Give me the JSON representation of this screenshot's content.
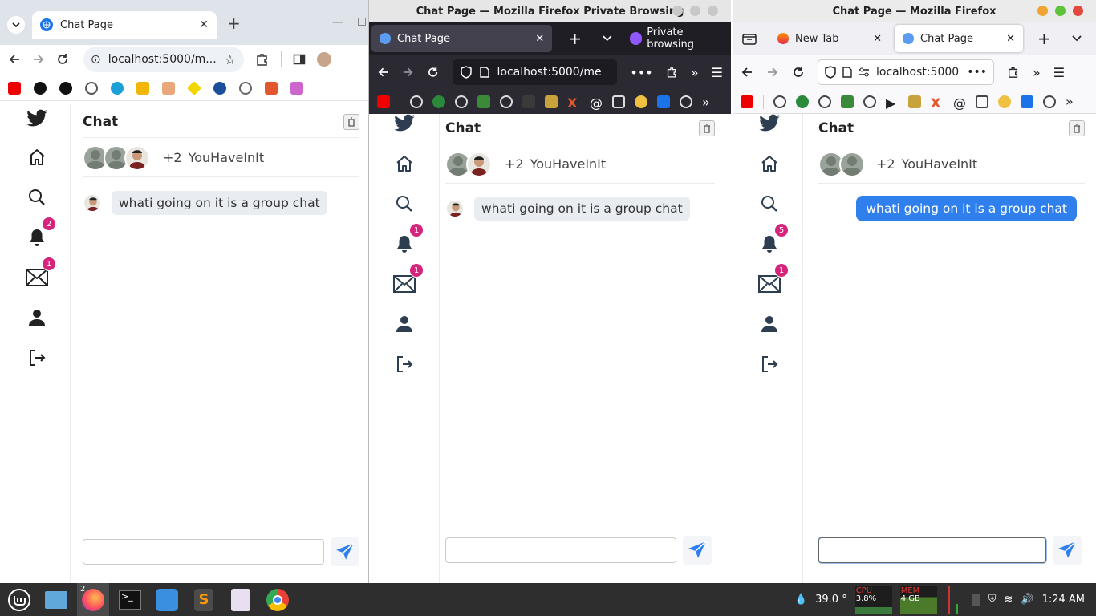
{
  "chrome": {
    "tab_title": "Chat Page",
    "url": "localhost:5000/m..."
  },
  "ff_private": {
    "window_title": "Chat Page — Mozilla Firefox Private Browsing",
    "tab_title": "Chat Page",
    "private_label": "Private browsing",
    "url": "localhost:5000/me"
  },
  "ff_normal": {
    "window_title": "Chat Page — Mozilla Firefox",
    "tabs": [
      {
        "label": "New Tab"
      },
      {
        "label": "Chat Page"
      }
    ],
    "url": "localhost:5000"
  },
  "app": {
    "chat_title": "Chat",
    "members_extra": "+2",
    "members_name": "YouHaveInIt",
    "message_text": "whati going on it is a group chat",
    "pages": [
      {
        "notif_badge": "2",
        "mail_badge": "1"
      },
      {
        "notif_badge": "1",
        "mail_badge": "1"
      },
      {
        "notif_badge": "5",
        "mail_badge": "1"
      }
    ]
  },
  "taskbar": {
    "firefox_count": "2",
    "temperature": "39.0 °",
    "cpu_label": "CPU",
    "cpu_value": "3.8%",
    "mem_label": "MEM",
    "mem_value": "4 GB",
    "clock": "1:24 AM"
  },
  "colors": {
    "accent_blue": "#2f80ed",
    "badge_pink": "#d6247d",
    "dark_firefox": "#2b2a33"
  }
}
